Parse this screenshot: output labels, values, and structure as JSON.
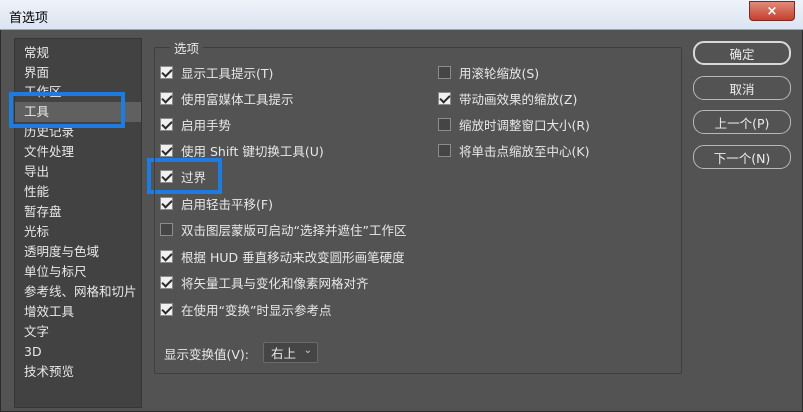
{
  "window": {
    "title": "首选项",
    "close_icon": "×"
  },
  "sidebar": {
    "items": [
      {
        "label": "常规"
      },
      {
        "label": "界面"
      },
      {
        "label": "工作区"
      },
      {
        "label": "工具"
      },
      {
        "label": "历史记录"
      },
      {
        "label": "文件处理"
      },
      {
        "label": "导出"
      },
      {
        "label": "性能"
      },
      {
        "label": "暂存盘"
      },
      {
        "label": "光标"
      },
      {
        "label": "透明度与色域"
      },
      {
        "label": "单位与标尺"
      },
      {
        "label": "参考线、网格和切片"
      },
      {
        "label": "增效工具"
      },
      {
        "label": "文字"
      },
      {
        "label": "3D"
      },
      {
        "label": "技术预览"
      }
    ],
    "selected_index": 3
  },
  "options_group": {
    "title": "选项",
    "left_column": [
      {
        "label": "显示工具提示(T)",
        "checked": true
      },
      {
        "label": "使用富媒体工具提示",
        "checked": true
      },
      {
        "label": "启用手势",
        "checked": true
      },
      {
        "label": "使用 Shift 键切换工具(U)",
        "checked": true
      },
      {
        "label": "过界",
        "checked": true
      },
      {
        "label": "启用轻击平移(F)",
        "checked": true
      },
      {
        "label": "双击图层蒙版可启动“选择并遮住”工作区",
        "checked": false
      },
      {
        "label": "根据 HUD 垂直移动来改变圆形画笔硬度",
        "checked": true
      },
      {
        "label": "将矢量工具与变化和像素网格对齐",
        "checked": true
      },
      {
        "label": "在使用“变换”时显示参考点",
        "checked": true
      }
    ],
    "right_column": [
      {
        "label": "用滚轮缩放(S)",
        "checked": false
      },
      {
        "label": "带动画效果的缩放(Z)",
        "checked": true
      },
      {
        "label": "缩放时调整窗口大小(R)",
        "checked": false
      },
      {
        "label": "将单击点缩放至中心(K)",
        "checked": false
      }
    ],
    "transform_values": {
      "label": "显示变换值(V):",
      "value": "右上"
    }
  },
  "buttons": {
    "ok": "确定",
    "cancel": "取消",
    "prev": "上一个(P)",
    "next": "下一个(N)"
  },
  "colors": {
    "highlight": "#1e7be0",
    "background": "#535353",
    "sidebar": "#424242"
  }
}
